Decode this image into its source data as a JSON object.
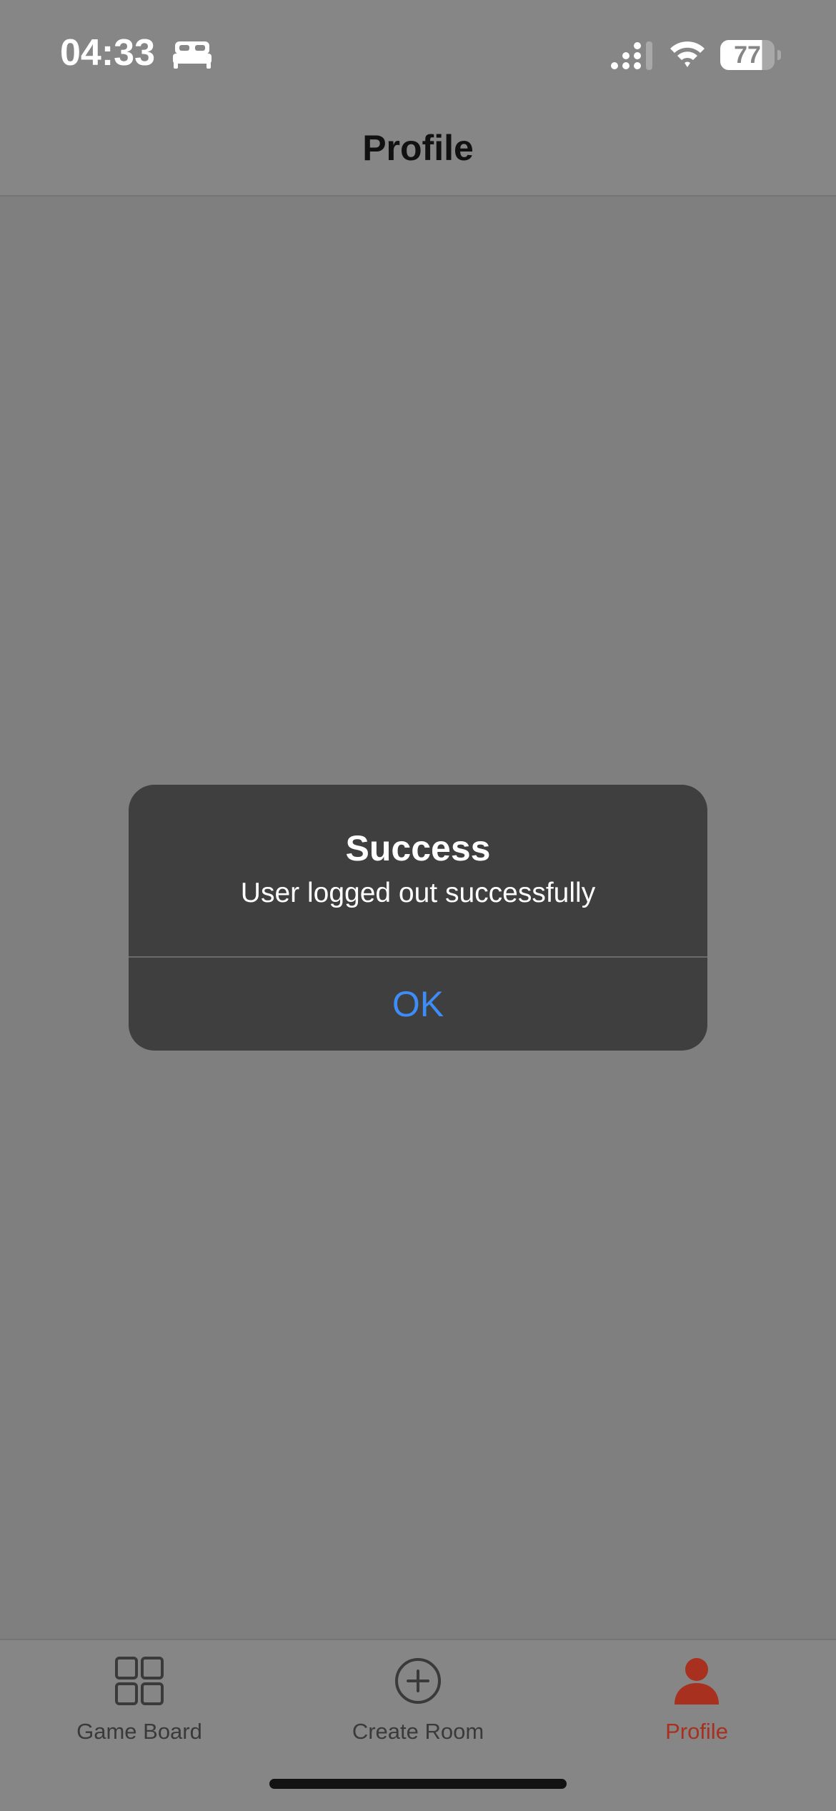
{
  "status_bar": {
    "time": "04:33",
    "focus_icon": "bed-icon",
    "battery_level": "77"
  },
  "header": {
    "title": "Profile"
  },
  "alert": {
    "title": "Success",
    "message": "User logged out successfully",
    "ok_label": "OK",
    "ok_color": "#3e8cf7"
  },
  "tab_bar": {
    "items": [
      {
        "label": "Game Board",
        "icon": "grid-icon",
        "active": false
      },
      {
        "label": "Create Room",
        "icon": "plus-circle-icon",
        "active": false
      },
      {
        "label": "Profile",
        "icon": "person-icon",
        "active": true
      }
    ],
    "active_color": "#a8301e",
    "inactive_color": "#3a3a3a"
  }
}
